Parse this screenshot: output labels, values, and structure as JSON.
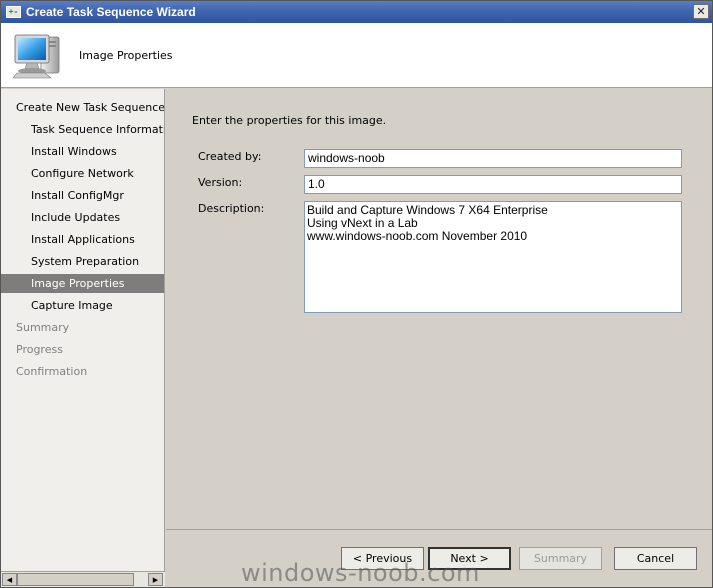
{
  "window": {
    "title": "Create Task Sequence Wizard",
    "close_glyph": "✕"
  },
  "header": {
    "title": "Image Properties",
    "icon": "computer-monitor-icon"
  },
  "nav": {
    "items": [
      {
        "label": "Create New Task Sequence",
        "level": "top",
        "state": "normal"
      },
      {
        "label": "Task Sequence Informatio",
        "level": "sub",
        "state": "normal"
      },
      {
        "label": "Install Windows",
        "level": "sub",
        "state": "normal"
      },
      {
        "label": "Configure Network",
        "level": "sub",
        "state": "normal"
      },
      {
        "label": "Install ConfigMgr",
        "level": "sub",
        "state": "normal"
      },
      {
        "label": "Include Updates",
        "level": "sub",
        "state": "normal"
      },
      {
        "label": "Install Applications",
        "level": "sub",
        "state": "normal"
      },
      {
        "label": "System Preparation",
        "level": "sub",
        "state": "normal"
      },
      {
        "label": "Image Properties",
        "level": "sub",
        "state": "selected"
      },
      {
        "label": "Capture Image",
        "level": "sub",
        "state": "normal"
      },
      {
        "label": "Summary",
        "level": "top",
        "state": "disabled"
      },
      {
        "label": "Progress",
        "level": "top",
        "state": "disabled"
      },
      {
        "label": "Confirmation",
        "level": "top",
        "state": "disabled"
      }
    ]
  },
  "content": {
    "intro": "Enter the properties for this image.",
    "created_by_label": "Created by:",
    "created_by_value": "windows-noob",
    "version_label": "Version:",
    "version_value": "1.0",
    "description_label": "Description:",
    "description_value": "Build and Capture Windows 7 X64 Enterprise\nUsing vNext in a Lab\nwww.windows-noob.com November 2010"
  },
  "footer": {
    "previous": "< Previous",
    "next": "Next >",
    "summary": "Summary",
    "cancel": "Cancel"
  },
  "watermark": "windows-noob.com",
  "colors": {
    "titlebar": "#3f65b0",
    "selected_nav": "#7e7d7b",
    "dialog_bg": "#d4d0c8"
  }
}
